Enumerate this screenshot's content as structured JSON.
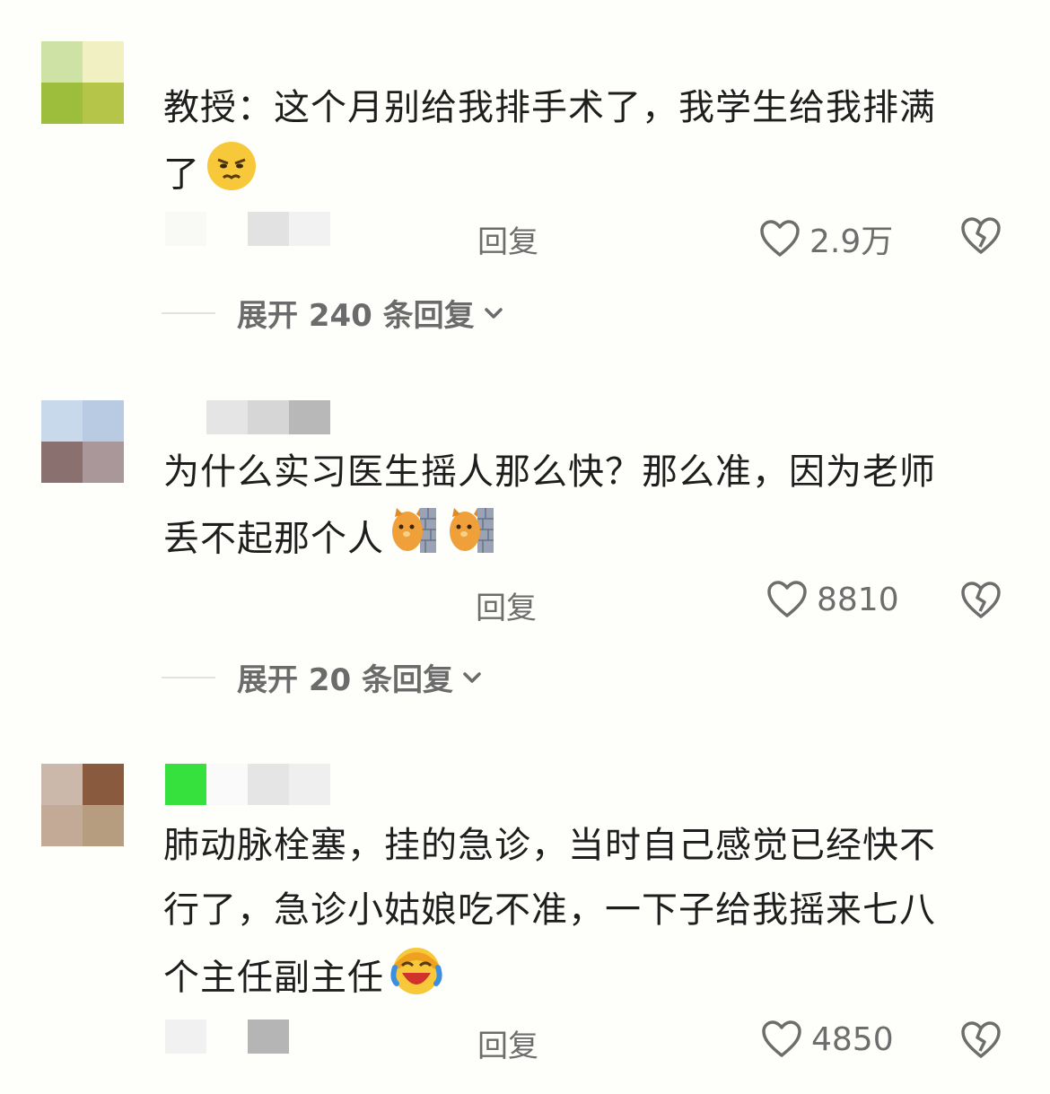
{
  "comments": [
    {
      "avatar_colors": [
        "#cfe2a6",
        "#f1f0c2",
        "#9dbd3c",
        "#b4c54a"
      ],
      "name_colors": [
        "#f9f9f6",
        "#fefefb",
        "#e2e2e2",
        "#f2f2f2"
      ],
      "text_line1": "教授：这个月别给我排手术了，我学生给我排满",
      "text_line2": "了",
      "emoji_icon": "annoyed-face-icon",
      "reply": "回复",
      "likes": "2.9万",
      "expand": "展开 240 条回复"
    },
    {
      "avatar_colors": [
        "#c9d9ec",
        "#b9cbe2",
        "#8a716f",
        "#a99799"
      ],
      "name_colors": [
        "#fefefb",
        "#e5e5e5",
        "#d6d6d6",
        "#b8b8b8"
      ],
      "text_line1": "为什么实习医生摇人那么快？那么准，因为老师",
      "text_line2": "丢不起那个人",
      "emoji_icon": "cat-peeking-wall-icon",
      "reply": "回复",
      "likes": "8810",
      "expand": "展开 20 条回复"
    },
    {
      "avatar_colors": [
        "#cbb8aa",
        "#8a5a3e",
        "#c3aa96",
        "#b79d80"
      ],
      "name_colors": [
        "#36e13d",
        "#fafafa",
        "#e5e5e5",
        "#efefef"
      ],
      "text_line1": "肺动脉栓塞，挂的急诊，当时自己感觉已经快不",
      "text_line2": "行了，急诊小姑娘吃不准，一下子给我摇来七八",
      "text_line3": "个主任副主任",
      "emoji_icon": "crying-laughing-face-icon",
      "reply": "回复",
      "likes": "4850"
    }
  ]
}
